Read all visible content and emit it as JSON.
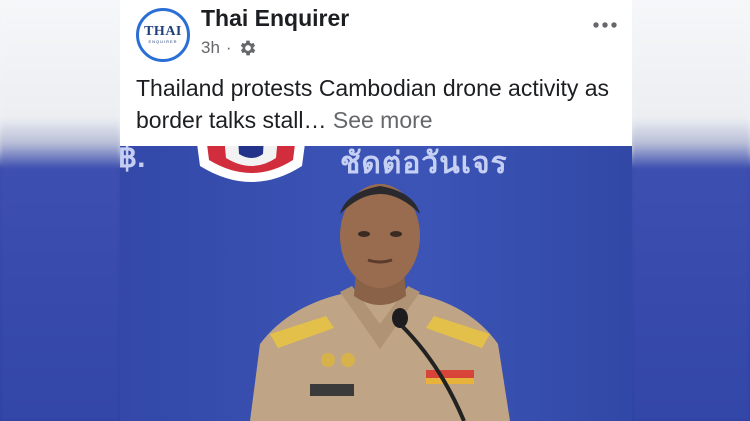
{
  "post": {
    "page_name": "Thai Enquirer",
    "time": "3h",
    "separator": "·",
    "privacy_icon": "gear-icon",
    "more_icon": "more-options-icon",
    "text": "Thailand protests Cambodian drone activity as border talks stall…",
    "see_more": "See more"
  },
  "avatar": {
    "logo_main": "THAI",
    "logo_sub": "ENQUIRER"
  },
  "photo": {
    "banner_left": "฿.",
    "banner_text": "ชัดต่อวันเจร"
  },
  "colors": {
    "accent": "#2a6fd6",
    "muted": "#65676b",
    "text": "#1c1e21",
    "photo_bg": "#3348a8"
  }
}
